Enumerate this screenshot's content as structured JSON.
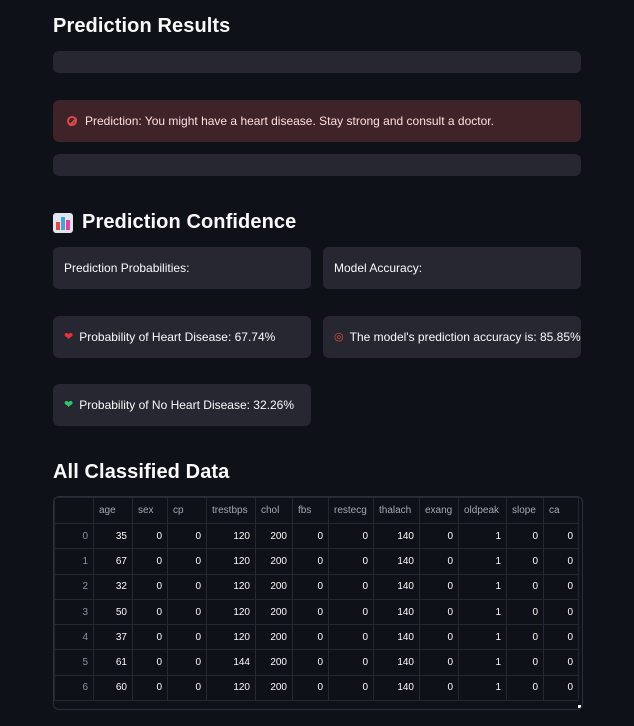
{
  "results": {
    "title": "Prediction Results",
    "error_text": "Prediction: You might have a heart disease. Stay strong and consult a doctor.",
    "error_icon": "no-entry-icon"
  },
  "confidence": {
    "title": "Prediction Confidence",
    "icon": "bar-chart-icon",
    "prob_header": "Prediction Probabilities:",
    "acc_header": "Model Accuracy:",
    "heart_disease": "Probability of Heart Disease: 67.74%",
    "heart_disease_icon": "red-heart-icon",
    "accuracy": "The model's prediction accuracy is: 85.85%",
    "accuracy_icon": "target-icon",
    "no_heart_disease": "Probability of No Heart Disease: 32.26%",
    "no_heart_disease_icon": "green-heart-icon"
  },
  "classified": {
    "title": "All Classified Data",
    "columns": [
      "",
      "age",
      "sex",
      "cp",
      "trestbps",
      "chol",
      "fbs",
      "restecg",
      "thalach",
      "exang",
      "oldpeak",
      "slope",
      "ca"
    ],
    "rows": [
      [
        "0",
        "35",
        "0",
        "0",
        "120",
        "200",
        "0",
        "0",
        "140",
        "0",
        "1",
        "0",
        "0"
      ],
      [
        "1",
        "67",
        "0",
        "0",
        "120",
        "200",
        "0",
        "0",
        "140",
        "0",
        "1",
        "0",
        "0"
      ],
      [
        "2",
        "32",
        "0",
        "0",
        "120",
        "200",
        "0",
        "0",
        "140",
        "0",
        "1",
        "0",
        "0"
      ],
      [
        "3",
        "50",
        "0",
        "0",
        "120",
        "200",
        "0",
        "0",
        "140",
        "0",
        "1",
        "0",
        "0"
      ],
      [
        "4",
        "37",
        "0",
        "0",
        "120",
        "200",
        "0",
        "0",
        "140",
        "0",
        "1",
        "0",
        "0"
      ],
      [
        "5",
        "61",
        "0",
        "0",
        "144",
        "200",
        "0",
        "0",
        "140",
        "0",
        "1",
        "0",
        "0"
      ],
      [
        "6",
        "60",
        "0",
        "0",
        "120",
        "200",
        "0",
        "0",
        "140",
        "0",
        "1",
        "0",
        "0"
      ]
    ]
  },
  "colors": {
    "background": "#0e1117",
    "card": "#262730",
    "error_bg": "#3e2428",
    "error_text": "#ffdede"
  }
}
